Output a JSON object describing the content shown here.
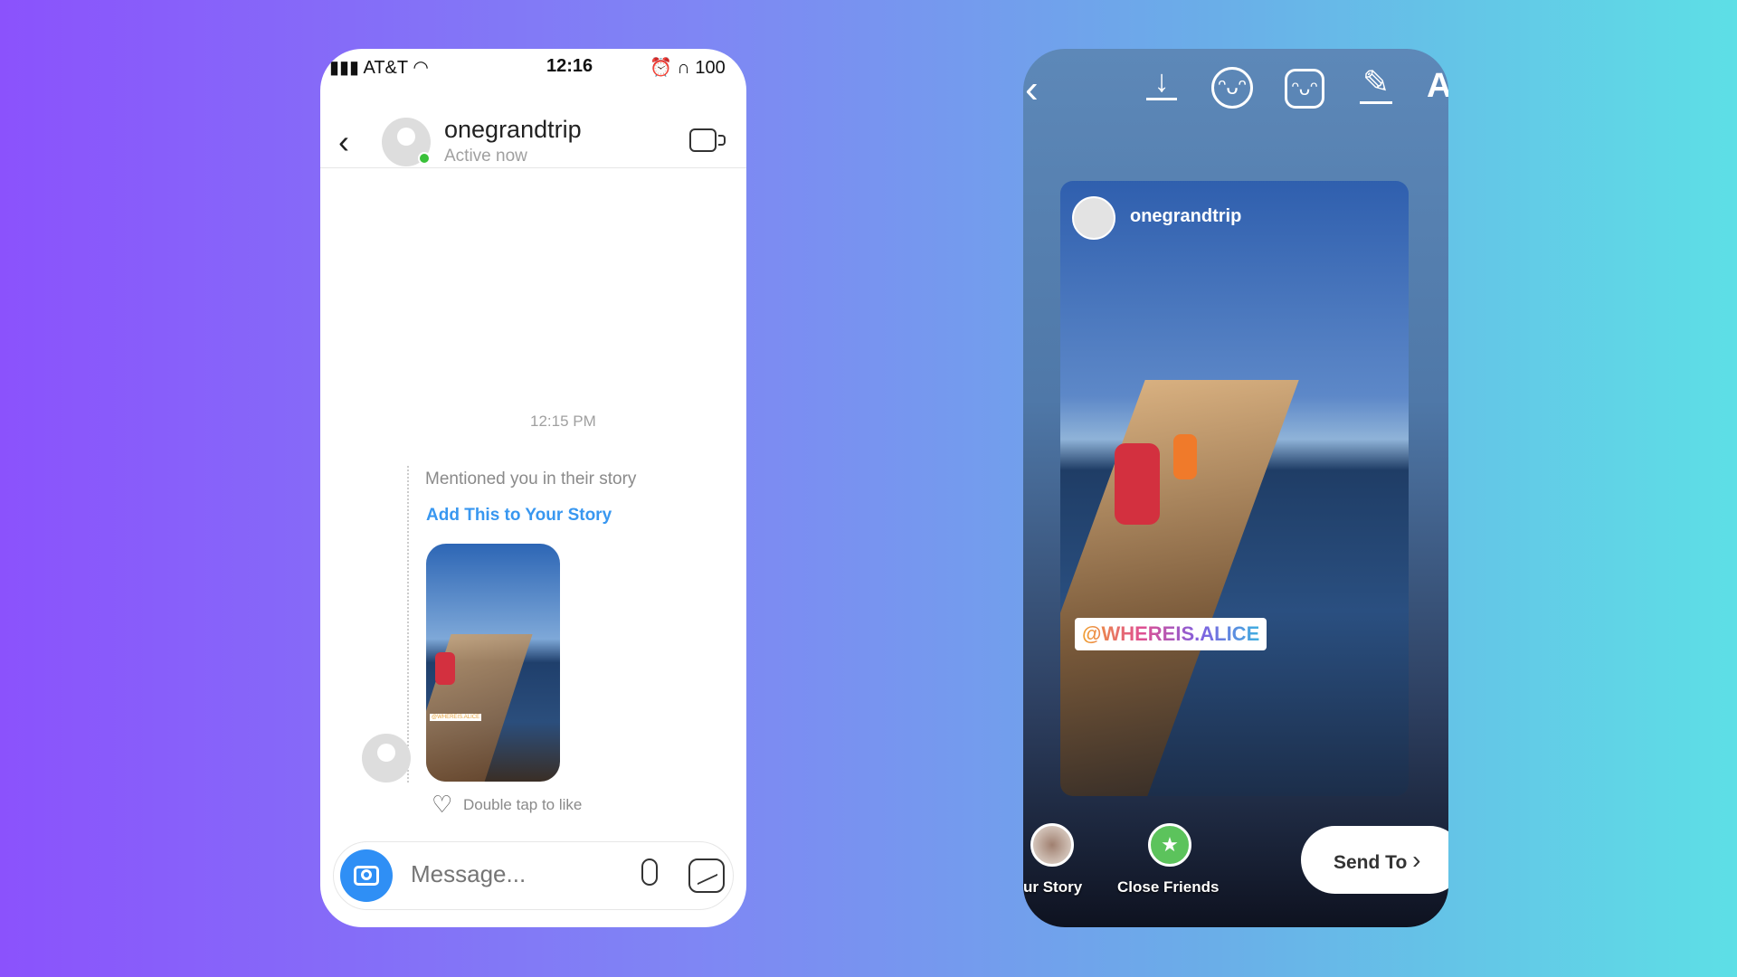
{
  "left_phone": {
    "status_bar": {
      "carrier": "AT&T",
      "time": "12:16",
      "battery": "100"
    },
    "header": {
      "username": "onegrandtrip",
      "status": "Active now",
      "online_color": "#3ac13a"
    },
    "chat": {
      "timestamp": "12:15 PM",
      "mention_text": "Mentioned you in their story",
      "add_story_link": "Add This to Your Story",
      "thumbnail_sticker": "@WHEREIS.ALICE",
      "like_hint": "Double tap to like"
    },
    "composer": {
      "placeholder": "Message..."
    }
  },
  "right_phone": {
    "toolbar": {
      "text_tool": "A",
      "icons": [
        "back-icon",
        "download-icon",
        "face-effects-icon",
        "sticker-icon",
        "draw-icon",
        "text-icon"
      ]
    },
    "story": {
      "username": "onegrandtrip",
      "mention_sticker": "@WHEREIS.ALICE"
    },
    "bottom": {
      "your_story": "ur Story",
      "close_friends": "Close Friends",
      "send_to": "Send To"
    },
    "accent_green": "#5cc35c"
  },
  "colors": {
    "link_blue": "#3897f0",
    "camera_blue": "#2f8ff5"
  }
}
